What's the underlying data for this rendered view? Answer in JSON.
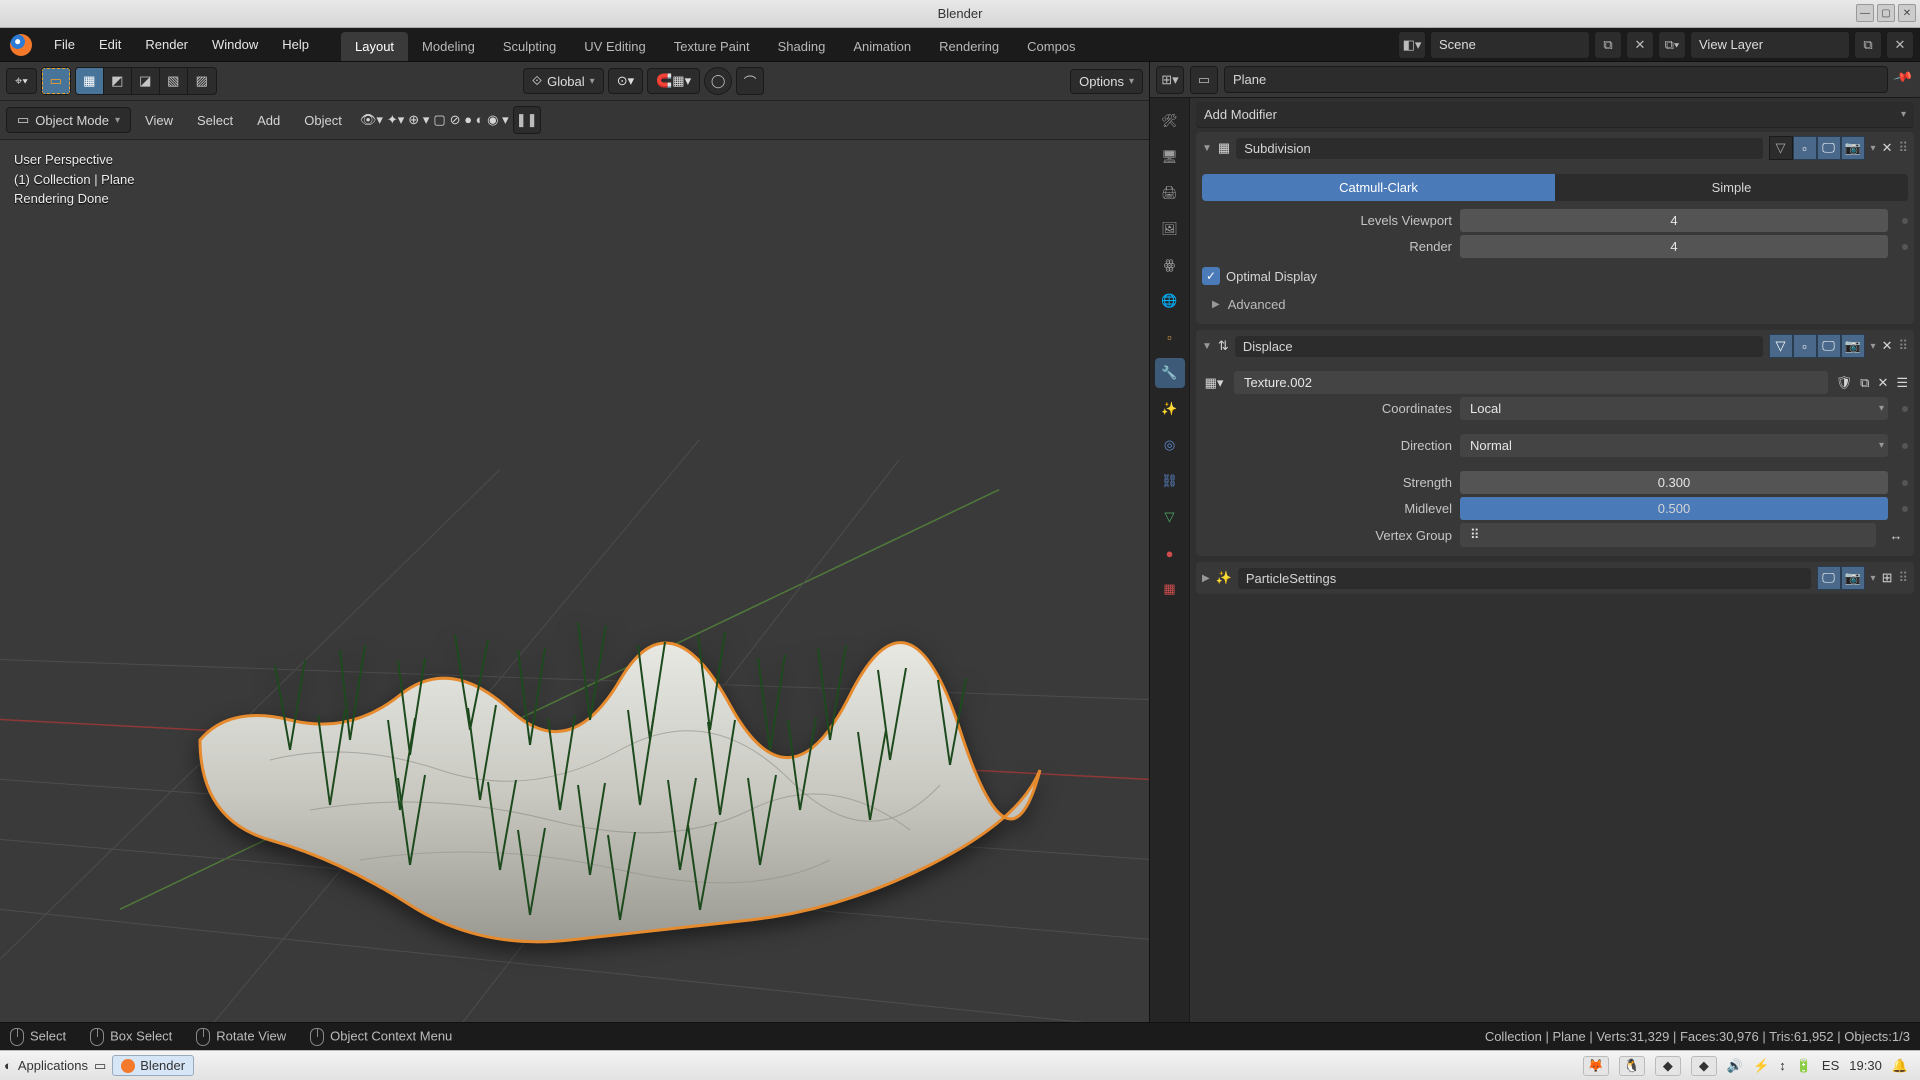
{
  "app": {
    "title": "Blender"
  },
  "menu": [
    "File",
    "Edit",
    "Render",
    "Window",
    "Help"
  ],
  "workspace_tabs": [
    "Layout",
    "Modeling",
    "Sculpting",
    "UV Editing",
    "Texture Paint",
    "Shading",
    "Animation",
    "Rendering",
    "Compos"
  ],
  "active_workspace": "Layout",
  "scene": {
    "name": "Scene"
  },
  "view_layer": {
    "name": "View Layer"
  },
  "viewport": {
    "transform_orientation": "Global",
    "mode": "Object Mode",
    "menus": [
      "View",
      "Select",
      "Add",
      "Object"
    ],
    "options_label": "Options",
    "overlay": {
      "view_label": "User Perspective",
      "collection_label": "(1) Collection | Plane",
      "render_status": "Rendering Done"
    }
  },
  "outliner": {
    "active_object": "Plane"
  },
  "properties": {
    "add_modifier_label": "Add Modifier",
    "modifiers": {
      "subdivision": {
        "name": "Subdivision",
        "type_options": [
          "Catmull-Clark",
          "Simple"
        ],
        "active_type": "Catmull-Clark",
        "levels_viewport_label": "Levels Viewport",
        "levels_viewport": "4",
        "render_label": "Render",
        "render": "4",
        "optimal_display_label": "Optimal Display",
        "optimal_display": true,
        "advanced_label": "Advanced"
      },
      "displace": {
        "name": "Displace",
        "texture": "Texture.002",
        "coordinates_label": "Coordinates",
        "coordinates": "Local",
        "direction_label": "Direction",
        "direction": "Normal",
        "strength_label": "Strength",
        "strength": "0.300",
        "midlevel_label": "Midlevel",
        "midlevel": "0.500",
        "vertex_group_label": "Vertex Group"
      },
      "particle": {
        "name": "ParticleSettings"
      }
    }
  },
  "statusbar": {
    "select": "Select",
    "box_select": "Box Select",
    "rotate": "Rotate View",
    "context_menu": "Object Context Menu",
    "stats": "Collection | Plane | Verts:31,329 | Faces:30,976 | Tris:61,952 | Objects:1/3"
  },
  "desktop": {
    "apps_label": "Applications",
    "task": "Blender",
    "lang": "ES",
    "time": "19:30"
  }
}
